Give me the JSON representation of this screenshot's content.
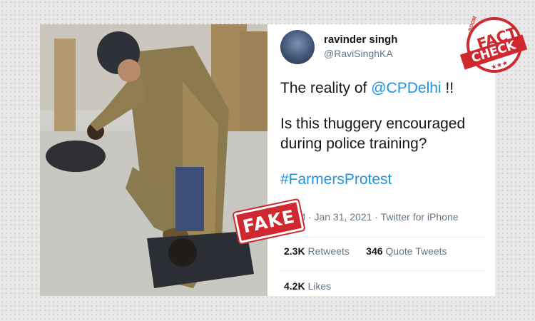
{
  "tweet": {
    "name": "ravinder singh",
    "handle": "@RaviSinghKA",
    "line1_prefix": "The reality of ",
    "mention": "@CPDelhi",
    "line1_suffix": " !!",
    "line2": "Is this thuggery encouraged during police training?",
    "hashtag": "#FarmersProtest",
    "meta": "…AM · Jan 31, 2021 · Twitter for iPhone",
    "retweets_count": "2.3K",
    "retweets_label": "Retweets",
    "quote_count": "346",
    "quote_label": "Quote Tweets",
    "likes_count": "4.2K",
    "likes_label": "Likes"
  },
  "stamp": {
    "text": "FAKE"
  },
  "badge": {
    "brand": "BOOM",
    "fact": "FACT",
    "check": "CHECK",
    "stars": "★★★"
  },
  "colors": {
    "accent_red": "#d0282f",
    "link_blue": "#1b95e0",
    "muted": "#657786"
  },
  "icons": {
    "photo": "police-photo"
  }
}
